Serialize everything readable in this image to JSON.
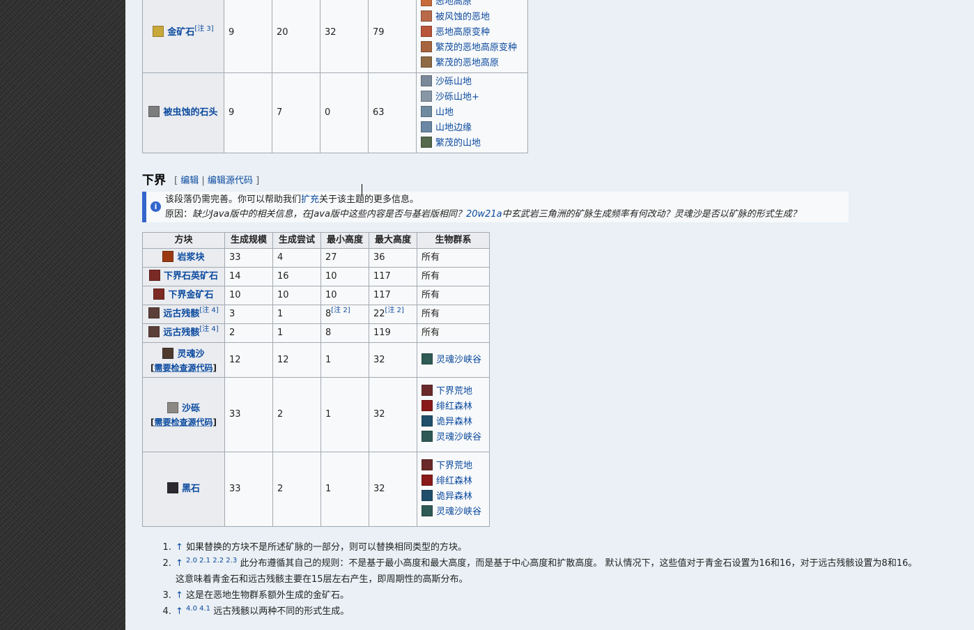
{
  "top_table": {
    "rows": [
      {
        "block": "金矿石",
        "note": "[注 3]",
        "color": "#c9a83a",
        "size": "9",
        "tries": "20",
        "min": "32",
        "max": "79",
        "biomes": [
          {
            "name": "恶地高原",
            "color": "#c76b3a"
          },
          {
            "name": "被风蚀的恶地",
            "color": "#b86a4a"
          },
          {
            "name": "恶地高原变种",
            "color": "#b9553a"
          },
          {
            "name": "繁茂的恶地高原变种",
            "color": "#a8643f"
          },
          {
            "name": "繁茂的恶地高原",
            "color": "#8e6b45"
          }
        ]
      },
      {
        "block": "被虫蚀的石头",
        "note": "",
        "color": "#7d7d7d",
        "size": "9",
        "tries": "7",
        "min": "0",
        "max": "63",
        "biomes": [
          {
            "name": "沙砾山地",
            "color": "#7a8a9a"
          },
          {
            "name": "沙砾山地+",
            "color": "#8897a6"
          },
          {
            "name": "山地",
            "color": "#6f8aa0"
          },
          {
            "name": "山地边缘",
            "color": "#6b87a4"
          },
          {
            "name": "繁茂的山地",
            "color": "#55694d"
          }
        ]
      }
    ]
  },
  "section": {
    "title": "下界",
    "edit_open": "[",
    "edit_label": "编辑",
    "edit_sep": "|",
    "edit_source_label": "编辑源代码",
    "edit_close": "]"
  },
  "notice": {
    "line1_before": "该段落仍需完善。你可以帮助我们",
    "line1_link": "扩充",
    "line1_after": "关于该主题的更多信息。",
    "line2_label": "原因：",
    "line2_text_a": "缺少Java版中的相关信息，在Java版中这些内容是否与基岩版相同？",
    "line2_link": "20w21a",
    "line2_text_b": "中玄武岩三角洲的矿脉生成频率有何改动？灵魂沙是否以矿脉的形式生成？"
  },
  "nether_table": {
    "headers": [
      "方块",
      "生成规模",
      "生成尝试",
      "最小高度",
      "最大高度",
      "生物群系"
    ],
    "rows": [
      {
        "block": "岩浆块",
        "note": "",
        "color": "#9a3a12",
        "size": "33",
        "tries": "4",
        "min": "27",
        "min_note": "",
        "max": "36",
        "max_note": "",
        "biome_text": "所有",
        "biomes": []
      },
      {
        "block": "下界石英矿石",
        "note": "",
        "color": "#7a2a24",
        "size": "14",
        "tries": "16",
        "min": "10",
        "min_note": "",
        "max": "117",
        "max_note": "",
        "biome_text": "所有",
        "biomes": []
      },
      {
        "block": "下界金矿石",
        "note": "",
        "color": "#7d2b22",
        "size": "10",
        "tries": "10",
        "min": "10",
        "min_note": "",
        "max": "117",
        "max_note": "",
        "biome_text": "所有",
        "biomes": []
      },
      {
        "block": "远古残骸",
        "note": "[注 4]",
        "color": "#5b4039",
        "size": "3",
        "tries": "1",
        "min": "8",
        "min_note": "[注 2]",
        "max": "22",
        "max_note": "[注 2]",
        "biome_text": "所有",
        "biomes": []
      },
      {
        "block": "远古残骸",
        "note": "[注 4]",
        "color": "#5b4039",
        "size": "2",
        "tries": "1",
        "min": "8",
        "min_note": "",
        "max": "119",
        "max_note": "",
        "biome_text": "所有",
        "biomes": []
      },
      {
        "block": "灵魂沙",
        "note": "",
        "sub": "需要检查源代码",
        "color": "#4e3b2e",
        "size": "12",
        "tries": "12",
        "min": "1",
        "min_note": "",
        "max": "32",
        "max_note": "",
        "biome_text": "",
        "biomes": [
          {
            "name": "灵魂沙峡谷",
            "color": "#2f5a55"
          }
        ]
      },
      {
        "block": "沙砾",
        "note": "",
        "sub": "需要检查源代码",
        "color": "#8c8884",
        "size": "33",
        "tries": "2",
        "min": "1",
        "min_note": "",
        "max": "32",
        "max_note": "",
        "biome_text": "",
        "biomes": [
          {
            "name": "下界荒地",
            "color": "#6b2a2a"
          },
          {
            "name": "绯红森林",
            "color": "#8a1a1a"
          },
          {
            "name": "诡异森林",
            "color": "#1f4f6a"
          },
          {
            "name": "灵魂沙峡谷",
            "color": "#2f5a55"
          }
        ]
      },
      {
        "block": "黑石",
        "note": "",
        "color": "#2c2a30",
        "size": "33",
        "tries": "2",
        "min": "1",
        "min_note": "",
        "max": "32",
        "max_note": "",
        "biome_text": "",
        "biomes": [
          {
            "name": "下界荒地",
            "color": "#6b2a2a"
          },
          {
            "name": "绯红森林",
            "color": "#8a1a1a"
          },
          {
            "name": "诡异森林",
            "color": "#1f4f6a"
          },
          {
            "name": "灵魂沙峡谷",
            "color": "#2f5a55"
          }
        ]
      }
    ]
  },
  "notes": [
    {
      "arrow": "↑",
      "refs": "",
      "text": "如果替换的方块不是所述矿脉的一部分，则可以替换相同类型的方块。"
    },
    {
      "arrow": "↑",
      "refs": "2.0 2.1 2.2 2.3",
      "text": "此分布遵循其自己的规则：不是基于最小高度和最大高度，而是基于中心高度和扩散高度。 默认情况下，这些值对于青金石设置为16和16，对于远古残骸设置为8和16。",
      "text2": "这意味着青金石和远古残骸主要在15层左右产生，即周期性的高斯分布。"
    },
    {
      "arrow": "↑",
      "refs": "",
      "text": "这是在恶地生物群系额外生成的金矿石。"
    },
    {
      "arrow": "↑",
      "refs": "4.0 4.1",
      "text": "远古残骸以两种不同的形式生成。"
    }
  ]
}
